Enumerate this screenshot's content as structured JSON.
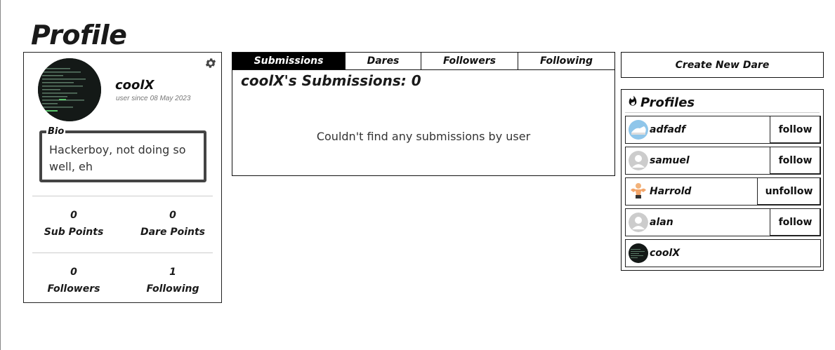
{
  "page": {
    "title": "Profile"
  },
  "profile": {
    "username": "coolX",
    "since_label": "user since",
    "since_date": "08 May 2023",
    "bio_label": "Bio",
    "bio": "Hackerboy, not doing so well, eh",
    "stats": [
      {
        "value": "0",
        "label": "Sub Points"
      },
      {
        "value": "0",
        "label": "Dare Points"
      },
      {
        "value": "0",
        "label": "Followers"
      },
      {
        "value": "1",
        "label": "Following"
      }
    ]
  },
  "tabs": [
    {
      "label": "Submissions",
      "active": true
    },
    {
      "label": "Dares",
      "active": false
    },
    {
      "label": "Followers",
      "active": false
    },
    {
      "label": "Following",
      "active": false
    }
  ],
  "submissions": {
    "heading": "coolX's Submissions: 0",
    "empty_message": "Couldn't find any submissions by user"
  },
  "create_button": "Create New Dare",
  "profiles_panel": {
    "title": "Profiles",
    "icon": "fire-icon",
    "items": [
      {
        "name": "adfadf",
        "action": "follow",
        "avatar": "shoe-photo"
      },
      {
        "name": "samuel",
        "action": "follow",
        "avatar": "default-user"
      },
      {
        "name": "Harrold",
        "action": "unfollow",
        "avatar": "muscle-man-emoji"
      },
      {
        "name": "alan",
        "action": "follow",
        "avatar": "default-user"
      },
      {
        "name": "coolX",
        "action": "",
        "avatar": "terminal-screenshot"
      }
    ]
  },
  "colors": {
    "text": "#111111",
    "active_tab_bg": "#000000",
    "bio_border": "#444444",
    "muted": "#777777"
  }
}
